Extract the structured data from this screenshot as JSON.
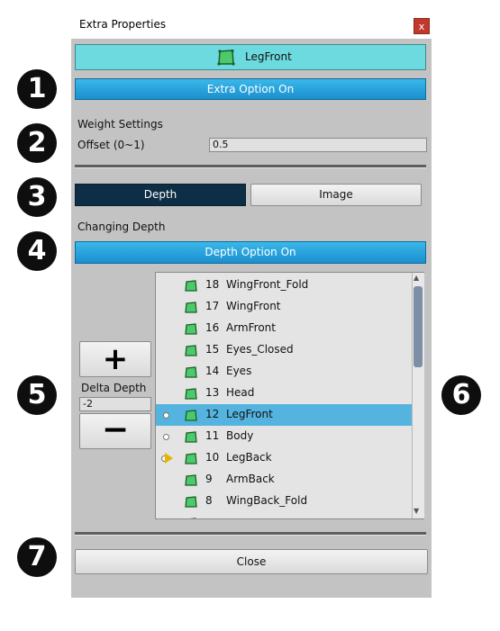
{
  "window": {
    "title": "Extra Properties",
    "close_label": "x"
  },
  "object_name": "LegFront",
  "extra_option_button": "Extra Option On",
  "weight": {
    "heading": "Weight Settings",
    "offset_label": "Offset (0~1)",
    "offset_value": "0.5"
  },
  "tabs": {
    "depth": "Depth",
    "image": "Image",
    "active": "Depth"
  },
  "changing_depth_label": "Changing Depth",
  "depth_option_button": "Depth Option On",
  "delta": {
    "label": "Delta Depth",
    "value": "-2",
    "plus": "+",
    "minus": "−"
  },
  "layers": [
    {
      "num": "18",
      "name": "WingFront_Fold",
      "marker": ""
    },
    {
      "num": "17",
      "name": "WingFront",
      "marker": ""
    },
    {
      "num": "16",
      "name": "ArmFront",
      "marker": ""
    },
    {
      "num": "15",
      "name": "Eyes_Closed",
      "marker": ""
    },
    {
      "num": "14",
      "name": "Eyes",
      "marker": ""
    },
    {
      "num": "13",
      "name": "Head",
      "marker": ""
    },
    {
      "num": "12",
      "name": "LegFront",
      "marker": "dot",
      "selected": true
    },
    {
      "num": "11",
      "name": "Body",
      "marker": "dot"
    },
    {
      "num": "10",
      "name": "LegBack",
      "marker": "arrow"
    },
    {
      "num": "9",
      "name": "ArmBack",
      "marker": ""
    },
    {
      "num": "8",
      "name": "WingBack_Fold",
      "marker": ""
    }
  ],
  "close_button": "Close",
  "badges": [
    "1",
    "2",
    "3",
    "4",
    "5",
    "6",
    "7"
  ],
  "colors": {
    "name_bar": "#6ddadf",
    "blue_button": "#1b8fcf",
    "active_tab": "#0d2e45",
    "selected_row": "#55b3df",
    "mesh_icon": "#4cc96a"
  }
}
